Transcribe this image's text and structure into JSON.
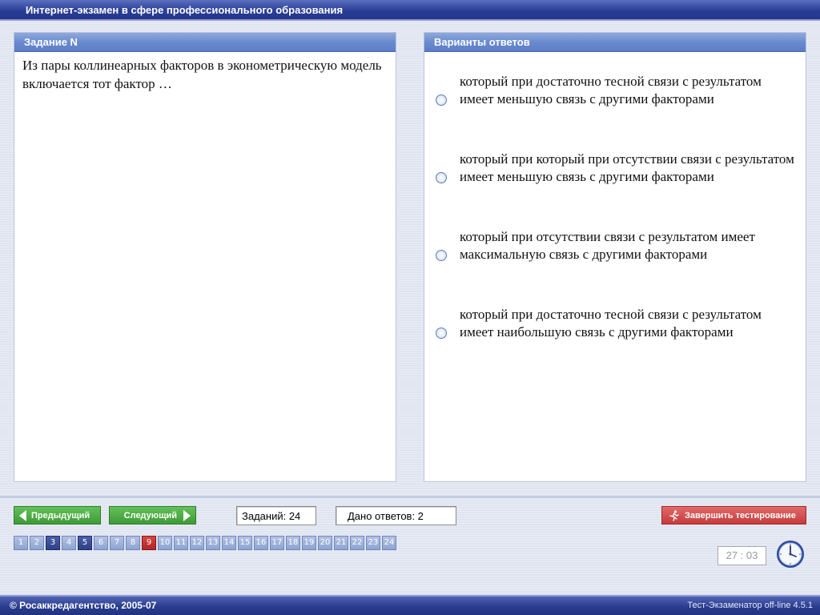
{
  "window": {
    "title": "Интернет-экзамен в сфере профессионального образования"
  },
  "question_panel": {
    "header": "Задание N",
    "text": "Из пары коллинеарных факторов в эконометрическую модель включается тот фактор …"
  },
  "answers_panel": {
    "header": "Варианты ответов",
    "options": [
      {
        "text": "который при достаточно тесной связи с результатом имеет меньшую связь с другими факторами",
        "selected": false
      },
      {
        "text": "который при который при отсутствии связи с результатом имеет меньшую связь с другими факторами",
        "selected": false
      },
      {
        "text": "который при отсутствии связи с результатом имеет максимальную связь с другими факторами",
        "selected": false
      },
      {
        "text": "который при достаточно тесной связи с результатом имеет наибольшую связь с другими факторами",
        "selected": false
      }
    ]
  },
  "nav": {
    "prev_label": "Предыдущий",
    "next_label": "Следующий",
    "tasks_label": "Заданий: 24",
    "answered_label": "Дано ответов: 2",
    "finish_label": "Завершить тестирование"
  },
  "pager": {
    "pages": [
      "1",
      "2",
      "3",
      "4",
      "5",
      "6",
      "7",
      "8",
      "9",
      "10",
      "11",
      "12",
      "13",
      "14",
      "15",
      "16",
      "17",
      "18",
      "19",
      "20",
      "21",
      "22",
      "23",
      "24"
    ],
    "answered": [
      "3",
      "5"
    ],
    "current": "9"
  },
  "timer": {
    "value": "27 : 03"
  },
  "footer": {
    "copyright": "© Росаккредагентство, 2005-07",
    "version": "Тест-Экзаменатор off-line 4.5.1"
  },
  "colors": {
    "accent_blue": "#2a3e96",
    "answered_page": "#2d3f88",
    "current_page": "#b22626",
    "nav_green": "#3d9a36",
    "finish_red": "#c73b3b"
  }
}
